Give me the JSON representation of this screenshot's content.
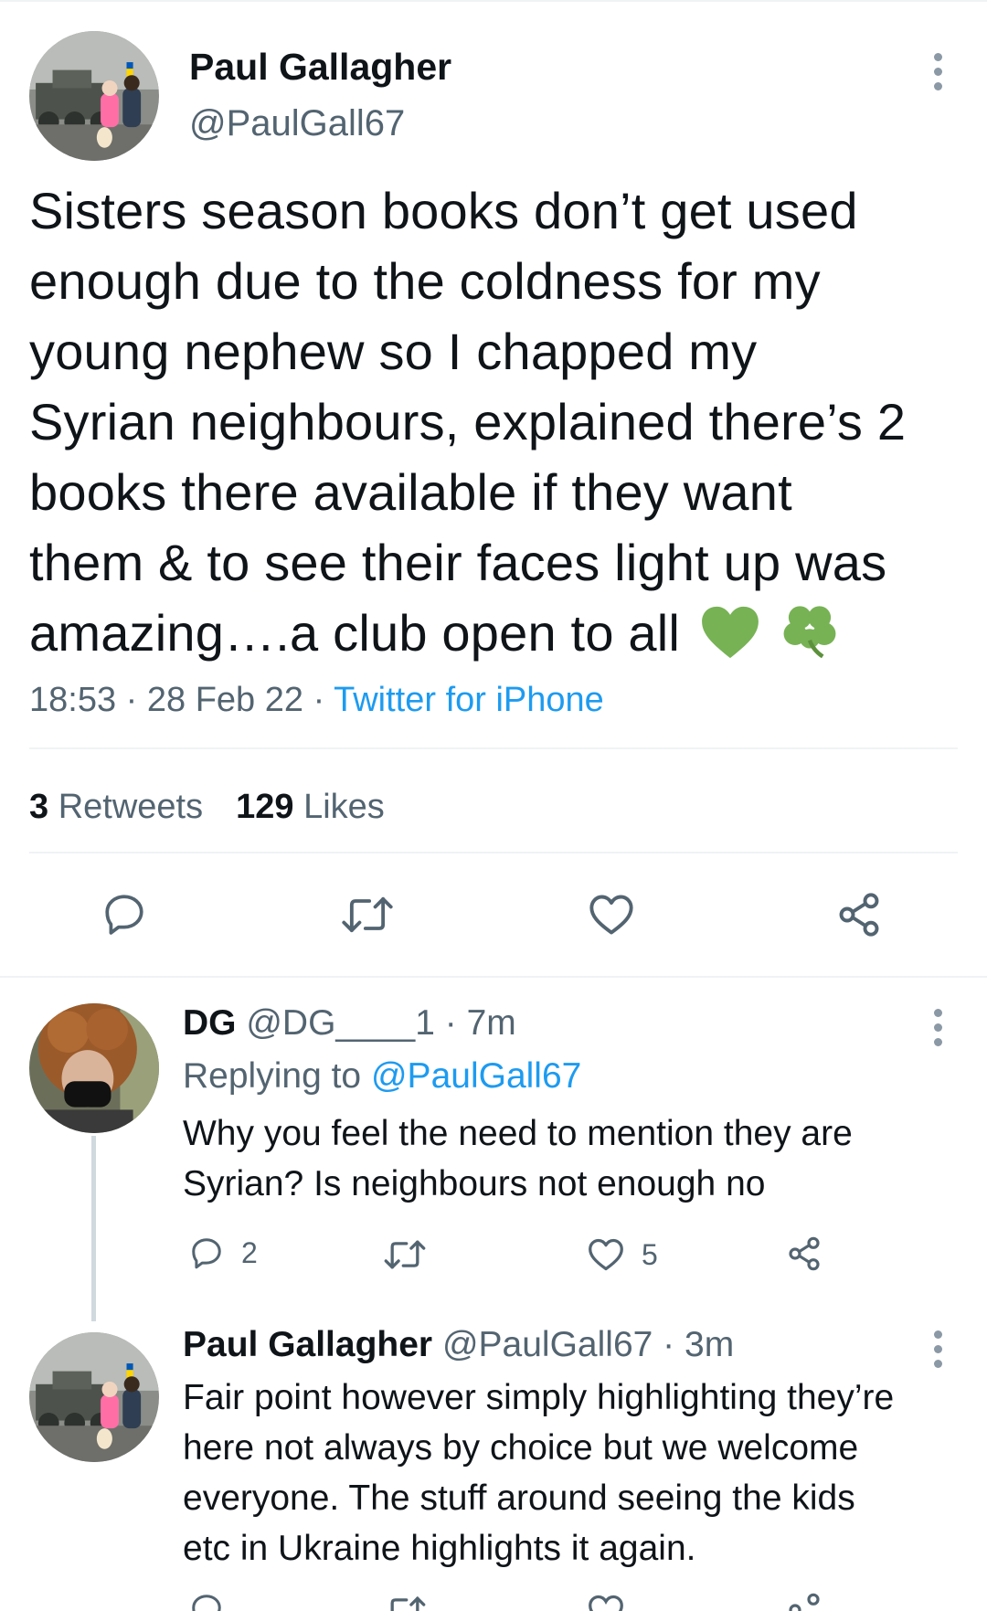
{
  "main_tweet": {
    "author_name": "Paul Gallagher",
    "author_handle": "@PaulGall67",
    "text_lines": [
      "Sisters season books don’t get used",
      "enough due to the coldness for my",
      "young nephew so I chapped my",
      "Syrian neighbours, explained there’s 2",
      "books there available if they want",
      "them & to see their faces light up was",
      "amazing….a club open to all"
    ],
    "emojis": [
      "green-heart",
      "shamrock"
    ],
    "time": "18:53",
    "date": "28 Feb 22",
    "source": "Twitter for iPhone",
    "separator": " · ",
    "retweets_count": "3",
    "retweets_label": "Retweets",
    "likes_count": "129",
    "likes_label": "Likes"
  },
  "replies": [
    {
      "author_name": "DG",
      "author_handle": "@DG____1",
      "time": "7m",
      "replying_label": "Replying to",
      "replying_to": "@PaulGall67",
      "text_lines": [
        "Why you feel the need to mention they are",
        "Syrian? Is neighbours not enough no"
      ],
      "reply_count": "2",
      "retweet_count": "",
      "like_count": "5"
    },
    {
      "author_name": "Paul Gallagher",
      "author_handle": "@PaulGall67",
      "time": "3m",
      "text_lines": [
        "Fair point however simply highlighting they’re",
        "here not always by choice but we welcome",
        "everyone. The stuff around seeing the kids",
        "etc in Ukraine highlights it again."
      ]
    }
  ],
  "icons": {
    "reply": "reply-icon",
    "retweet": "retweet-icon",
    "like": "heart-icon",
    "share": "share-icon",
    "more": "more-vertical-icon"
  },
  "colors": {
    "link": "#1d9bf0",
    "secondary_text": "#536471",
    "emoji_green": "#77b255"
  }
}
